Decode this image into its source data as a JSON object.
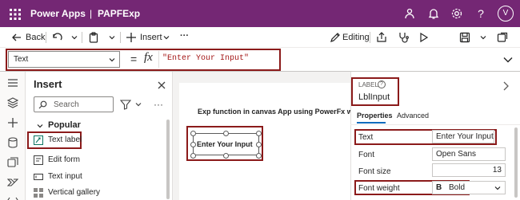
{
  "titlebar": {
    "app_name": "Power Apps",
    "separator": "|",
    "app_title": "PAPFExp",
    "avatar_initial": "V",
    "help_label": "?"
  },
  "commandbar": {
    "back_label": "Back",
    "insert_label": "Insert",
    "more_label": "···",
    "editing_label": "Editing"
  },
  "formulabar": {
    "property": "Text",
    "equals": "=",
    "fx": "fx",
    "formula": "\"Enter Your Input\""
  },
  "insert_pane": {
    "title": "Insert",
    "search_placeholder": "Search",
    "section": "Popular",
    "items": [
      {
        "label": "Text label"
      },
      {
        "label": "Edit form"
      },
      {
        "label": "Text input"
      },
      {
        "label": "Vertical gallery"
      }
    ]
  },
  "canvas": {
    "heading": "Exp function in canvas App using PowerFx w",
    "label_text": "Enter Your Input"
  },
  "properties_pane": {
    "type_label": "LABEL",
    "control_name": "LblInput",
    "tabs": [
      {
        "label": "Properties"
      },
      {
        "label": "Advanced"
      }
    ],
    "rows": {
      "text_label": "Text",
      "text_value": "Enter Your Input",
      "font_label": "Font",
      "font_value": "Open Sans",
      "size_label": "Font size",
      "size_value": "13",
      "weight_label": "Font weight",
      "weight_icon_text": "B",
      "weight_value": "Bold"
    }
  },
  "colors": {
    "brand": "#742774",
    "highlight_border": "#8b1a1a",
    "accent": "#0f6cbd"
  }
}
